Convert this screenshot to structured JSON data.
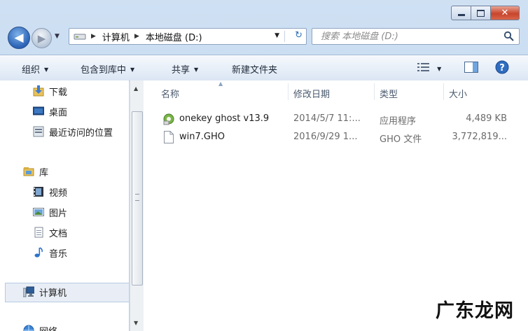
{
  "window": {
    "controls": {
      "min": "minimize-icon",
      "max": "maximize-icon",
      "close": "close-icon"
    }
  },
  "address": {
    "crumbs": [
      "计算机",
      "本地磁盘 (D:)"
    ]
  },
  "search": {
    "placeholder": "搜索 本地磁盘 (D:)"
  },
  "toolbar": {
    "organize": "组织",
    "include_in_library": "包含到库中",
    "share": "共享",
    "new_folder": "新建文件夹"
  },
  "nav": {
    "favorites": [
      {
        "label": "下载",
        "icon": "downloads-folder-icon"
      },
      {
        "label": "桌面",
        "icon": "desktop-icon"
      },
      {
        "label": "最近访问的位置",
        "icon": "recent-places-icon"
      }
    ],
    "libraries": {
      "label": "库",
      "icon": "library-icon"
    },
    "library_items": [
      {
        "label": "视频",
        "icon": "video-icon"
      },
      {
        "label": "图片",
        "icon": "pictures-icon"
      },
      {
        "label": "文档",
        "icon": "documents-icon"
      },
      {
        "label": "音乐",
        "icon": "music-icon"
      }
    ],
    "computer": {
      "label": "计算机",
      "icon": "computer-icon"
    },
    "network": {
      "label": "网络",
      "icon": "network-icon"
    }
  },
  "columns": [
    "名称",
    "修改日期",
    "类型",
    "大小"
  ],
  "files": [
    {
      "name": "onekey ghost v13.9",
      "date": "2014/5/7 11:...",
      "type": "应用程序",
      "size": "4,489 KB",
      "icon": "application-icon"
    },
    {
      "name": "win7.GHO",
      "date": "2016/9/29 1...",
      "type": "GHO 文件",
      "size": "3,772,819...",
      "icon": "file-icon"
    }
  ],
  "watermark": "广东龙网",
  "colors": {
    "accent": "#2b63b6",
    "close": "#c8452c"
  }
}
